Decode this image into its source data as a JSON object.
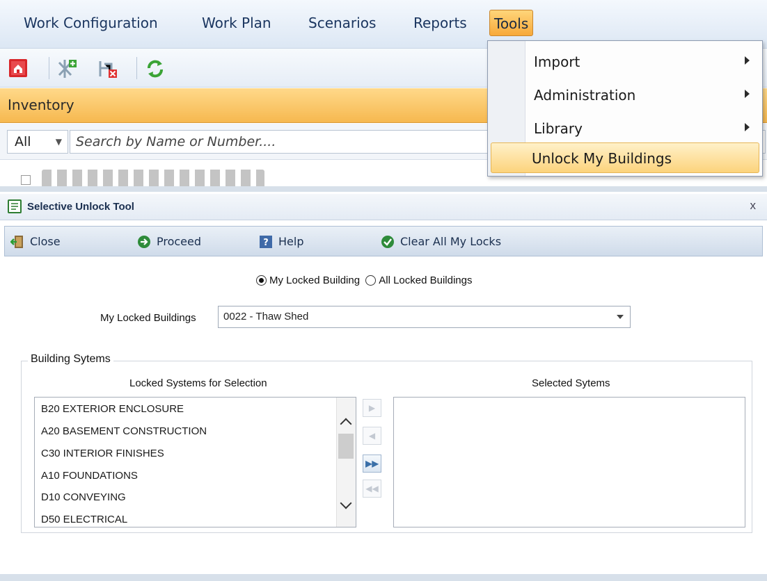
{
  "menubar": {
    "items": [
      {
        "label": "Work Configuration"
      },
      {
        "label": "Work Plan"
      },
      {
        "label": "Scenarios"
      },
      {
        "label": "Reports"
      },
      {
        "label": "Tools"
      }
    ]
  },
  "inventory": {
    "title": "Inventory",
    "filter_value": "All",
    "search_placeholder": "Search by Name or Number...."
  },
  "tools_menu": {
    "items": [
      {
        "label": "Import",
        "has_submenu": true
      },
      {
        "label": "Administration",
        "has_submenu": true
      },
      {
        "label": "Library",
        "has_submenu": true
      },
      {
        "label": "Unlock My Buildings",
        "has_submenu": false,
        "highlighted": true
      }
    ]
  },
  "unlock_tool": {
    "title": "Selective Unlock Tool",
    "close_x": "x",
    "toolbar": {
      "close_label": "Close",
      "proceed_label": "Proceed",
      "help_label": "Help",
      "clear_locks_label": "Clear All My Locks"
    },
    "radio": {
      "my_locked_label": "My Locked Building",
      "all_locked_label": "All Locked Buildings",
      "selected": "my_locked"
    },
    "my_locked_buildings_label": "My Locked Buildings",
    "my_locked_buildings_value": "0022 - Thaw Shed",
    "group_title": "Building Sytems",
    "available_header": "Locked Systems for Selection",
    "selected_header": "Selected Sytems",
    "available_systems": [
      "B20 EXTERIOR ENCLOSURE",
      "A20 BASEMENT CONSTRUCTION",
      "C30 INTERIOR FINISHES",
      "A10 FOUNDATIONS",
      "D10 CONVEYING",
      "D50 ELECTRICAL"
    ],
    "move_buttons": [
      {
        "glyph": "▶",
        "enabled": false
      },
      {
        "glyph": "◀",
        "enabled": false
      },
      {
        "glyph": "▶▶",
        "enabled": true
      },
      {
        "glyph": "◀◀",
        "enabled": false
      }
    ]
  },
  "colors": {
    "accent_orange": "#f6b84f",
    "menu_text": "#1b3660",
    "toolbar_blue": "#cfdbea"
  }
}
